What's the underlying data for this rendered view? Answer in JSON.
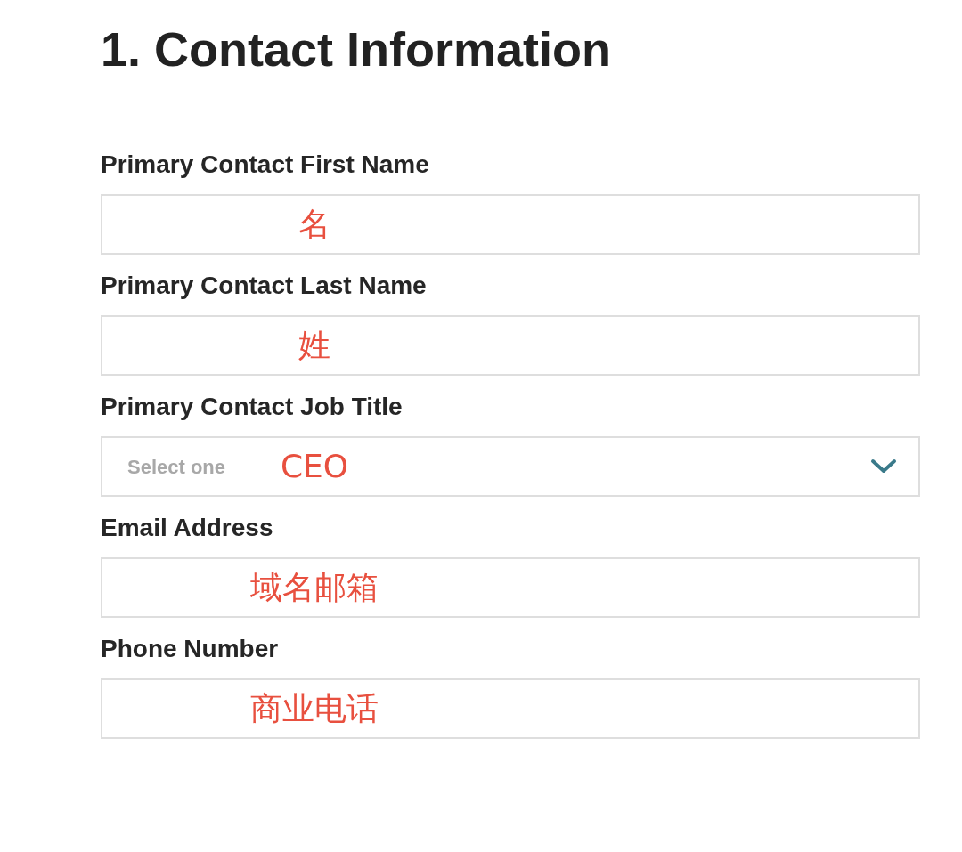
{
  "heading": "1. Contact Information",
  "fields": [
    {
      "label": "Primary Contact First Name",
      "kind": "text",
      "annotation": "名"
    },
    {
      "label": "Primary Contact Last Name",
      "kind": "text",
      "annotation": "姓"
    },
    {
      "label": "Primary Contact Job Title",
      "kind": "select",
      "placeholder": "Select one",
      "annotation": "CEO"
    },
    {
      "label": "Email Address",
      "kind": "text",
      "annotation": "域名邮箱"
    },
    {
      "label": "Phone Number",
      "kind": "text",
      "annotation": "商业电话"
    }
  ]
}
